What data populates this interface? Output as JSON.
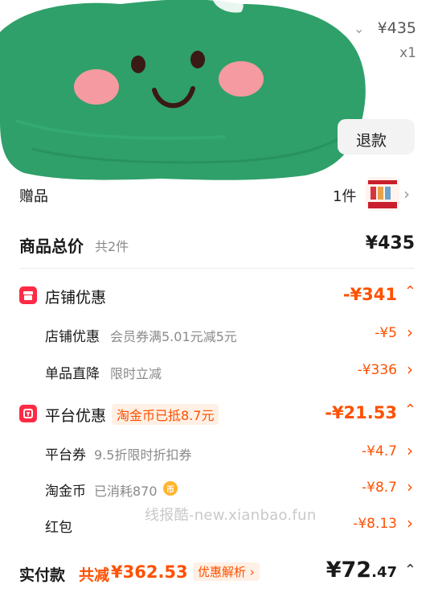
{
  "top_item": {
    "price": "¥435",
    "quantity": "x1",
    "refund_label": "退款"
  },
  "gift": {
    "label": "赠品",
    "count": "1件"
  },
  "total": {
    "label": "商品总价",
    "count": "共2件",
    "amount": "¥435"
  },
  "store_discount": {
    "title": "店铺优惠",
    "amount": "-¥341",
    "items": [
      {
        "label": "店铺优惠",
        "desc": "会员券满5.01元减5元",
        "amount": "-¥5"
      },
      {
        "label": "单品直降",
        "desc": "限时立减",
        "amount": "-¥336"
      }
    ]
  },
  "platform_discount": {
    "title": "平台优惠",
    "tag": "淘金币已抵8.7元",
    "amount": "-¥21.53",
    "items": [
      {
        "label": "平台券",
        "desc": "9.5折限时折扣券",
        "amount": "-¥4.7"
      },
      {
        "label": "淘金币",
        "desc": "已消耗870",
        "amount": "-¥8.7"
      },
      {
        "label": "红包",
        "desc": "",
        "amount": "-¥8.13"
      }
    ]
  },
  "watermark": "线报酷-new.xianbao.fun",
  "footer": {
    "label": "实付款",
    "saved_prefix": "共减",
    "saved_amount": "¥362.53",
    "breakdown_label": "优惠解析",
    "pay_int": "¥72",
    "pay_dec": ".47"
  },
  "colors": {
    "accent": "#ff5000",
    "badge_red": "#ff2a45",
    "blob_green": "#2fa06a",
    "cheek_pink": "#f49aa0"
  }
}
